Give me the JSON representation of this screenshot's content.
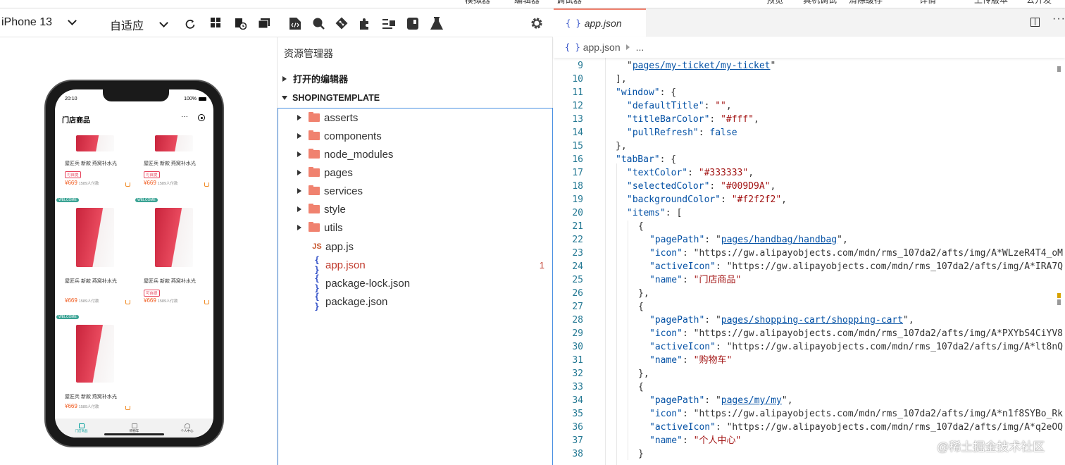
{
  "top_menu": [
    "模拟器",
    "编辑器",
    "调试器",
    "预览",
    "真机调试",
    "清除缓存",
    "详情",
    "上传版本",
    "公开发"
  ],
  "simulator": {
    "device": "iPhone 13",
    "zoom": "自适应",
    "phone": {
      "status_time": "20:10",
      "status_battery": "100%",
      "page_title": "门店商品",
      "more": "···",
      "products": [
        {
          "name": "屋匠兵 新款 燕窝补水光",
          "badge": "可自提",
          "price": "¥669",
          "sold": "1589人付款",
          "tag": ""
        },
        {
          "name": "屋匠兵 新款 燕窝补水光",
          "badge": "可自提",
          "price": "¥669",
          "sold": "1589人付款",
          "tag": ""
        },
        {
          "name": "屋匠兵 新款 燕窝补水光",
          "badge": "",
          "price": "¥669",
          "sold": "1589人付款",
          "tag": "WELCOME"
        },
        {
          "name": "屋匠兵 新款 燕窝补水光",
          "badge": "可自提",
          "price": "¥669",
          "sold": "1589人付款",
          "tag": "WELCOME"
        },
        {
          "name": "屋匠兵 新款 燕窝补水光",
          "badge": "",
          "price": "¥669",
          "sold": "1589人付款",
          "tag": "WELCOME"
        }
      ],
      "tabs": [
        {
          "label": "门店商品",
          "active": true
        },
        {
          "label": "购物车",
          "active": false
        },
        {
          "label": "个人中心",
          "active": false
        }
      ]
    }
  },
  "explorer": {
    "title": "资源管理器",
    "open_editors": "打开的编辑器",
    "project": "SHOPINGTEMPLATE",
    "items": [
      {
        "label": "asserts",
        "type": "folder"
      },
      {
        "label": "components",
        "type": "folder"
      },
      {
        "label": "node_modules",
        "type": "folder"
      },
      {
        "label": "pages",
        "type": "folder"
      },
      {
        "label": "services",
        "type": "folder"
      },
      {
        "label": "style",
        "type": "folder"
      },
      {
        "label": "utils",
        "type": "folder"
      },
      {
        "label": "app.js",
        "type": "js",
        "icon": "JS"
      },
      {
        "label": "app.json",
        "type": "json",
        "icon": "{ }",
        "selected": true,
        "count": "1"
      },
      {
        "label": "package-lock.json",
        "type": "json",
        "icon": "{ }"
      },
      {
        "label": "package.json",
        "type": "json",
        "icon": "{ }"
      }
    ]
  },
  "editor": {
    "tab_icon": "{ }",
    "tab_name": "app.json",
    "breadcrumb_file": "app.json",
    "breadcrumb_more": "...",
    "more": "···",
    "lines": [
      {
        "n": "9",
        "t": "\"pages/my-ticket/my-ticket\""
      },
      {
        "n": "10",
        "t": "],"
      },
      {
        "n": "11",
        "t": "\"window\": {"
      },
      {
        "n": "12",
        "t": "\"defaultTitle\": \"\","
      },
      {
        "n": "13",
        "t": "\"titleBarColor\": \"#fff\","
      },
      {
        "n": "14",
        "t": "\"pullRefresh\": false"
      },
      {
        "n": "15",
        "t": "},"
      },
      {
        "n": "16",
        "t": "\"tabBar\": {"
      },
      {
        "n": "17",
        "t": "\"textColor\": \"#333333\","
      },
      {
        "n": "18",
        "t": "\"selectedColor\": \"#009D9A\","
      },
      {
        "n": "19",
        "t": "\"backgroundColor\": \"#f2f2f2\","
      },
      {
        "n": "20",
        "t": "\"items\": ["
      },
      {
        "n": "21",
        "t": "{"
      },
      {
        "n": "22",
        "t": "\"pagePath\": \"pages/handbag/handbag\","
      },
      {
        "n": "23",
        "t": "\"icon\": \"https://gw.alipayobjects.com/mdn/rms_107da2/afts/img/A*WLzeR4T4_oM"
      },
      {
        "n": "24",
        "t": "\"activeIcon\": \"https://gw.alipayobjects.com/mdn/rms_107da2/afts/img/A*IRA7Q"
      },
      {
        "n": "25",
        "t": "\"name\": \"门店商品\""
      },
      {
        "n": "26",
        "t": "},"
      },
      {
        "n": "27",
        "t": "{"
      },
      {
        "n": "28",
        "t": "\"pagePath\": \"pages/shopping-cart/shopping-cart\","
      },
      {
        "n": "29",
        "t": "\"icon\": \"https://gw.alipayobjects.com/mdn/rms_107da2/afts/img/A*PXYbS4CiYV8"
      },
      {
        "n": "30",
        "t": "\"activeIcon\": \"https://gw.alipayobjects.com/mdn/rms_107da2/afts/img/A*lt8nQ"
      },
      {
        "n": "31",
        "t": "\"name\": \"购物车\""
      },
      {
        "n": "32",
        "t": "},"
      },
      {
        "n": "33",
        "t": "{"
      },
      {
        "n": "34",
        "t": "\"pagePath\": \"pages/my/my\","
      },
      {
        "n": "35",
        "t": "\"icon\": \"https://gw.alipayobjects.com/mdn/rms_107da2/afts/img/A*n1f8SYBo_Rk"
      },
      {
        "n": "36",
        "t": "\"activeIcon\": \"https://gw.alipayobjects.com/mdn/rms_107da2/afts/img/A*q2eOQ"
      },
      {
        "n": "37",
        "t": "\"name\": \"个人中心\""
      },
      {
        "n": "38",
        "t": "}"
      }
    ]
  },
  "watermark": "@稀土掘金技术社区",
  "colors": {
    "accent": "#009D9A",
    "folder": "#f0826f",
    "link": "#0451a5",
    "string": "#a31515",
    "price": "#f05a1e"
  }
}
